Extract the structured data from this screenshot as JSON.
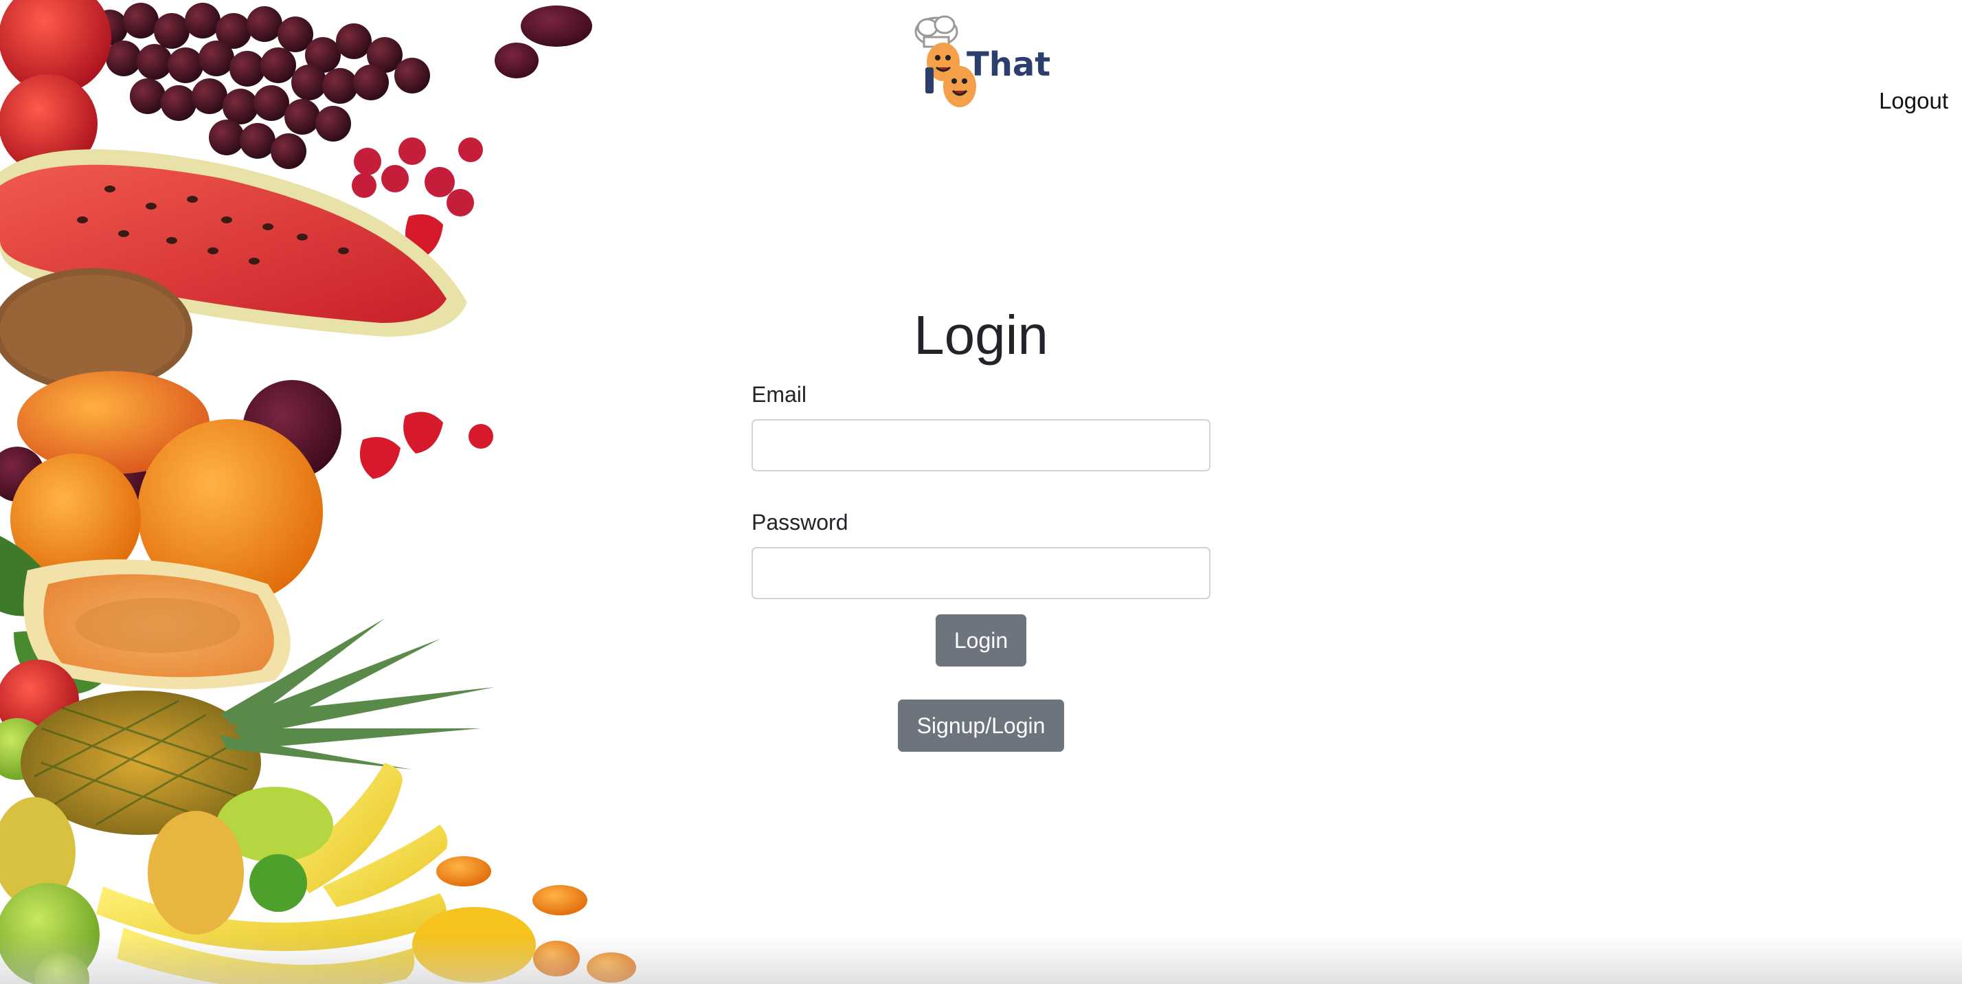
{
  "header": {
    "logo_icon": "i-that-chef-logo",
    "logo_text": "That",
    "logout_label": "Logout"
  },
  "decor": {
    "image": "fruit-assortment"
  },
  "login_form": {
    "title": "Login",
    "email_label": "Email",
    "email_value": "",
    "password_label": "Password",
    "password_value": "",
    "submit_label": "Login",
    "signup_label": "Signup/Login"
  },
  "colors": {
    "button_bg": "#6c757d",
    "logo_text": "#2c3e6b",
    "logo_face": "#f4a04a"
  }
}
